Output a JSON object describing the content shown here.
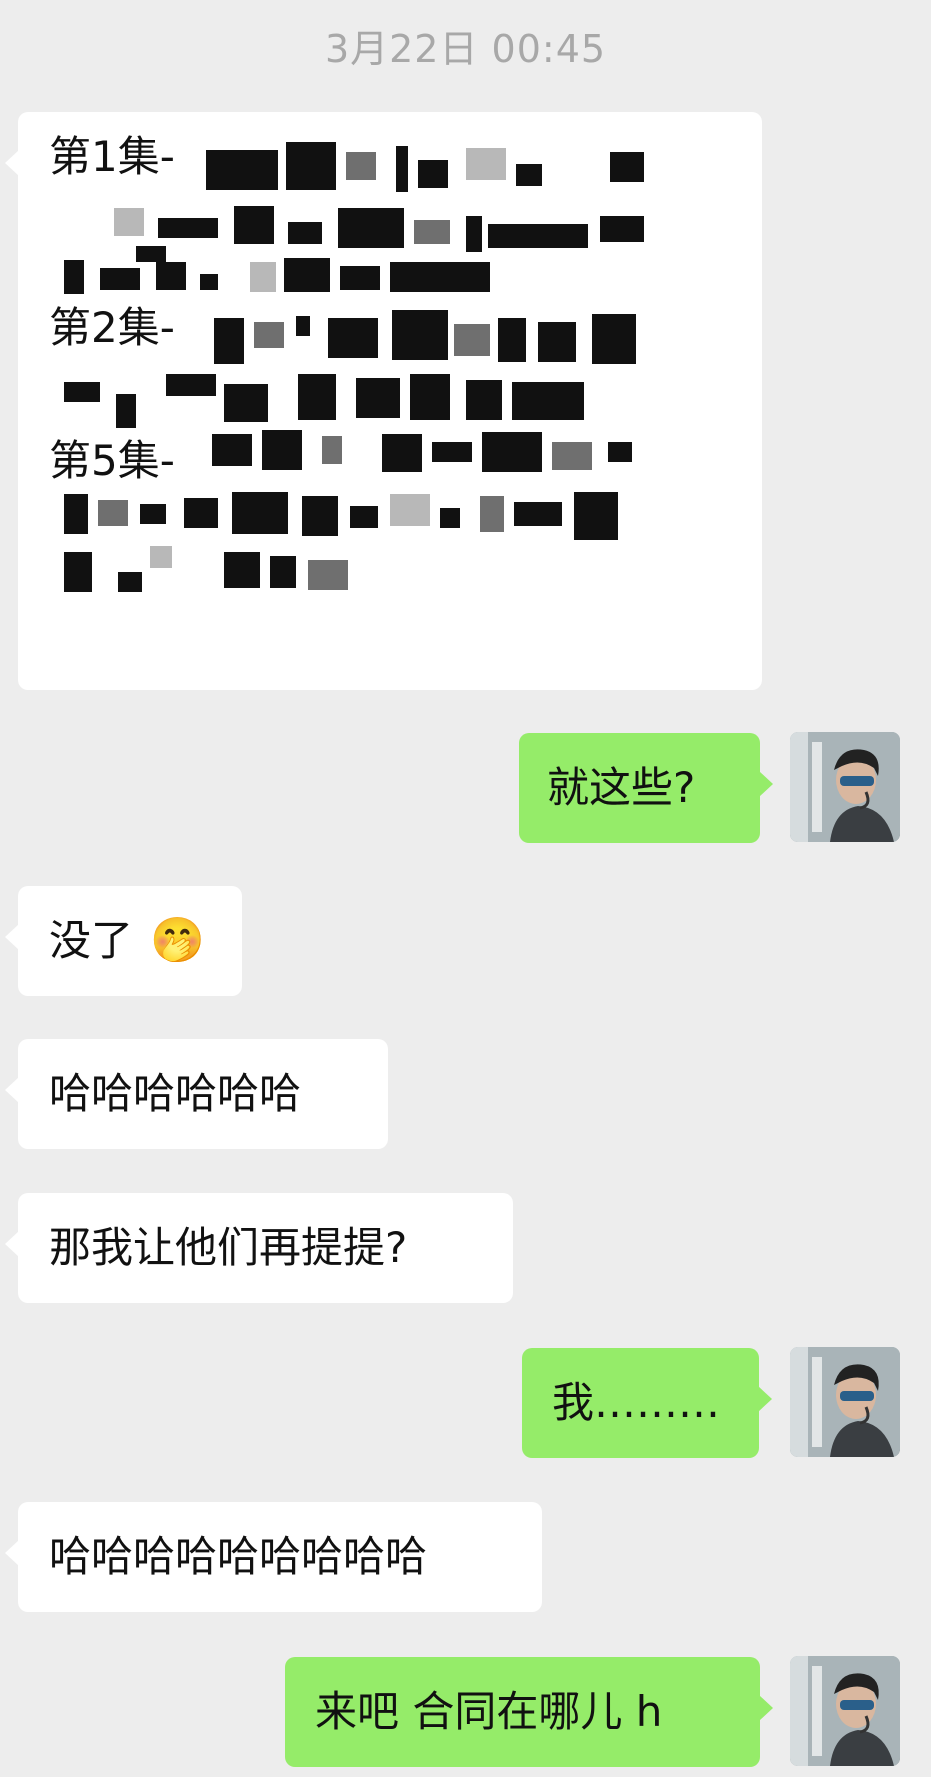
{
  "timestamp": "3月22日 00:45",
  "messages": {
    "m1": {
      "sender": "other",
      "lines": [
        "第1集-",
        "第2集-",
        "第5集-"
      ],
      "redacted": true
    },
    "m2": {
      "sender": "me",
      "text": "就这些?"
    },
    "m3": {
      "sender": "other",
      "text": "没了",
      "emoji": "🤭"
    },
    "m4": {
      "sender": "other",
      "text": "哈哈哈哈哈哈"
    },
    "m5": {
      "sender": "other",
      "text": "那我让他们再提提?"
    },
    "m6": {
      "sender": "me",
      "text": "我………"
    },
    "m7": {
      "sender": "other",
      "text": "哈哈哈哈哈哈哈哈哈"
    },
    "m8": {
      "sender": "me",
      "text": "来吧 合同在哪儿 h"
    }
  },
  "colors": {
    "background": "#ededed",
    "incoming_bubble": "#ffffff",
    "outgoing_bubble": "#95ec69",
    "timestamp": "#a8a8a8"
  },
  "icons": {
    "avatar": "user-avatar-photo",
    "emoji": "face-with-hand-over-mouth-emoji"
  }
}
